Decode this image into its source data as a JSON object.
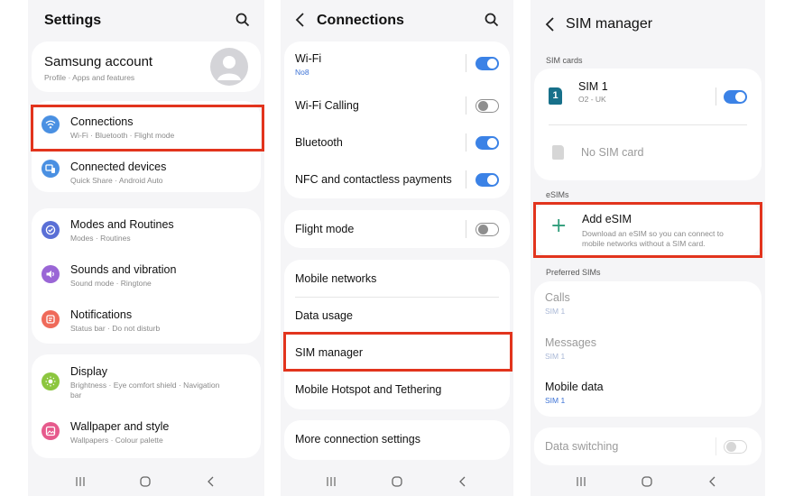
{
  "screens": {
    "settings": {
      "title": "Settings",
      "account": {
        "name": "Samsung account",
        "subtitle": "Profile  ·  Apps and features"
      },
      "items": [
        {
          "label": "Connections",
          "sub": "Wi-Fi  ·  Bluetooth  ·  Flight mode",
          "icon": "wifi-icon",
          "color": "#4a90e2"
        },
        {
          "label": "Connected devices",
          "sub": "Quick Share  ·  Android Auto",
          "icon": "devices-icon",
          "color": "#4a90e2"
        },
        {
          "label": "Modes and Routines",
          "sub": "Modes  ·  Routines",
          "icon": "check-icon",
          "color": "#5a6fd6"
        },
        {
          "label": "Sounds and vibration",
          "sub": "Sound mode  ·  Ringtone",
          "icon": "speaker-icon",
          "color": "#9a66d6"
        },
        {
          "label": "Notifications",
          "sub": "Status bar  ·  Do not disturb",
          "icon": "bell-icon",
          "color": "#ef6a5a"
        },
        {
          "label": "Display",
          "sub_line1": "Brightness  ·  Eye comfort shield  ·  Navigation",
          "sub_line2": "bar",
          "icon": "sun-icon",
          "color": "#8cc63f"
        },
        {
          "label": "Wallpaper and style",
          "sub": "Wallpapers  ·  Colour palette",
          "icon": "image-icon",
          "color": "#e65a8c"
        }
      ]
    },
    "connections": {
      "title": "Connections",
      "group1": [
        {
          "label": "Wi-Fi",
          "sub": "No8",
          "toggle": true
        },
        {
          "label": "Wi-Fi Calling",
          "toggle": false
        },
        {
          "label": "Bluetooth",
          "toggle": true
        },
        {
          "label": "NFC and contactless payments",
          "toggle": true
        }
      ],
      "flight": {
        "label": "Flight mode",
        "toggle": false
      },
      "group2": [
        {
          "label": "Mobile networks"
        },
        {
          "label": "Data usage"
        },
        {
          "label": "SIM manager"
        },
        {
          "label": "Mobile Hotspot and Tethering"
        }
      ],
      "more": {
        "label": "More connection settings"
      }
    },
    "sim_manager": {
      "title": "SIM manager",
      "sim_cards_header": "SIM cards",
      "sim1": {
        "label": "SIM 1",
        "sub": "O2 - UK",
        "badge": "1",
        "toggle": true
      },
      "no_sim": {
        "label": "No SIM card"
      },
      "esims_header": "eSIMs",
      "add_esim": {
        "label": "Add eSIM",
        "sub_line1": "Download an eSIM so you can connect to",
        "sub_line2": "mobile networks without a SIM card.",
        "plus": "+"
      },
      "preferred_header": "Preferred SIMs",
      "preferred": [
        {
          "label": "Calls",
          "sub": "SIM 1",
          "enabled": false
        },
        {
          "label": "Messages",
          "sub": "SIM 1",
          "enabled": false
        },
        {
          "label": "Mobile data",
          "sub": "SIM 1",
          "enabled": true
        }
      ],
      "data_switching": {
        "label": "Data switching",
        "toggle": false
      }
    }
  },
  "colors": {
    "accent": "#3b82e6",
    "highlight": "#e2341d"
  }
}
